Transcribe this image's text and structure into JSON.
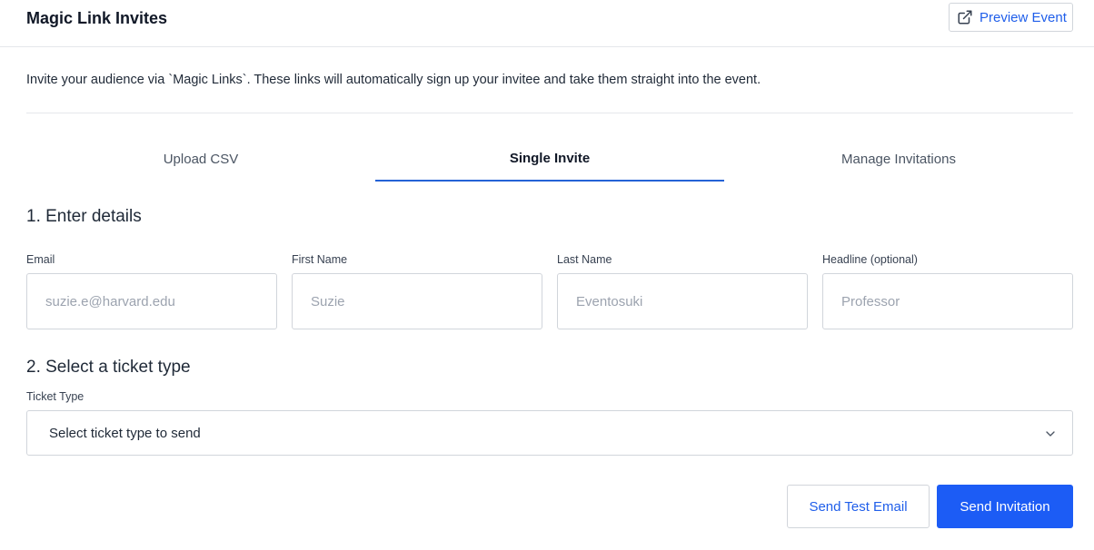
{
  "header": {
    "title": "Magic Link Invites",
    "preview_button": {
      "label": "Preview Event",
      "icon": "external-link-icon"
    }
  },
  "intro_text": "Invite your audience via `Magic Links`. These links will automatically sign up your invitee and take them straight into the event.",
  "tabs": [
    {
      "label": "Upload CSV",
      "active": false
    },
    {
      "label": "Single Invite",
      "active": true
    },
    {
      "label": "Manage Invitations",
      "active": false
    }
  ],
  "details_section": {
    "title": "1. Enter details",
    "fields": [
      {
        "label": "Email",
        "placeholder": "suzie.e@harvard.edu",
        "value": ""
      },
      {
        "label": "First Name",
        "placeholder": "Suzie",
        "value": ""
      },
      {
        "label": "Last Name",
        "placeholder": "Eventosuki",
        "value": ""
      },
      {
        "label": "Headline (optional)",
        "placeholder": "Professor",
        "value": ""
      }
    ]
  },
  "ticket_section": {
    "title": "2. Select a ticket type",
    "label": "Ticket Type",
    "selected": "Select ticket type to send",
    "icon": "chevron-down-icon"
  },
  "actions": {
    "test_email": "Send Test Email",
    "send_invitation": "Send Invitation"
  },
  "colors": {
    "accent": "#1c5cf5",
    "link": "#1f5eea",
    "tab_underline": "#2462d6",
    "border": "#d1d5db"
  }
}
